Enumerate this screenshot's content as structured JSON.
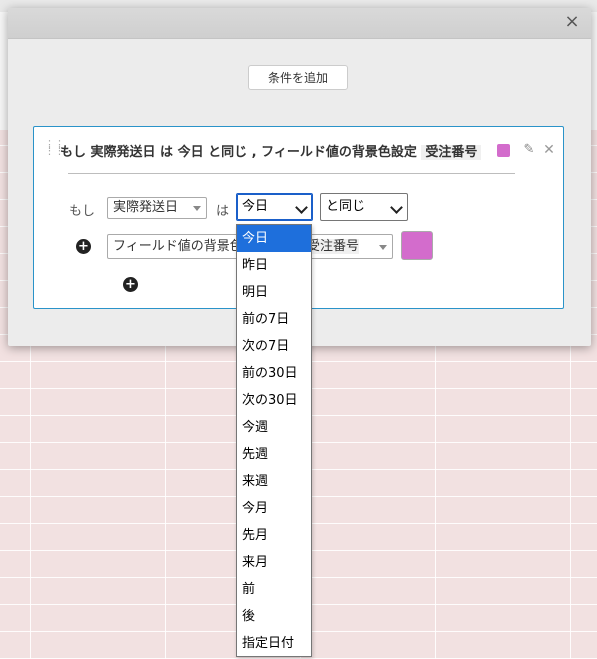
{
  "dialog": {
    "add_condition_label": "条件を追加",
    "close_glyph": "×"
  },
  "rule": {
    "summary_prefix": "もし 実際発送日 は 今日 と同じ , フィールド値の背景色設定",
    "summary_field": "受注番号",
    "swatch_color": "#d36ccc",
    "if_label": "もし",
    "field_select": "実際発送日",
    "is_label": "は",
    "date_select": "今日",
    "op_select": "と同じ",
    "action_select": "フィールド値の背景色",
    "target_field": "受注番号",
    "color_value": "#d36ccc"
  },
  "dropdown": {
    "selected": "今日",
    "options": [
      "今日",
      "昨日",
      "明日",
      "前の7日",
      "次の7日",
      "前の30日",
      "次の30日",
      "今週",
      "先週",
      "来週",
      "今月",
      "先月",
      "来月",
      "前",
      "後",
      "指定日付"
    ]
  }
}
